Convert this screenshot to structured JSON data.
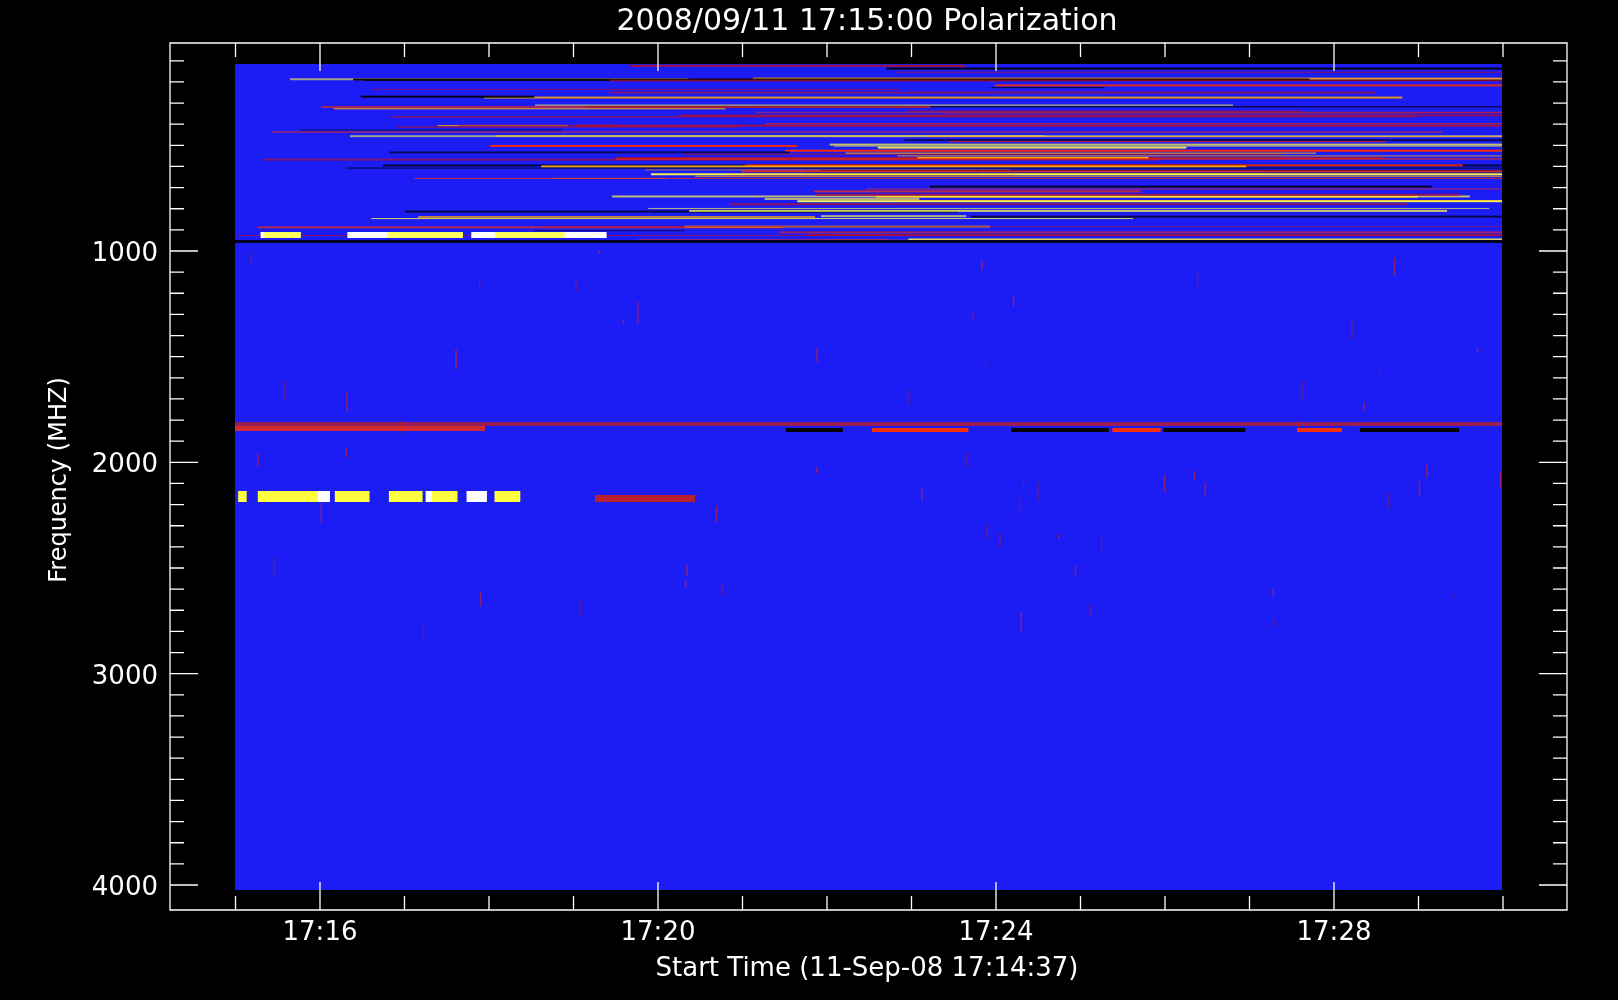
{
  "title": "2008/09/11 17:15:00 Polarization",
  "y_axis": {
    "title": "Frequency (MHZ)",
    "tick_labels": [
      "1000",
      "2000",
      "3000",
      "4000"
    ]
  },
  "x_axis": {
    "title": "Start Time (11-Sep-08 17:14:37)",
    "tick_labels": [
      "17:16",
      "17:20",
      "17:24",
      "17:28"
    ]
  }
}
